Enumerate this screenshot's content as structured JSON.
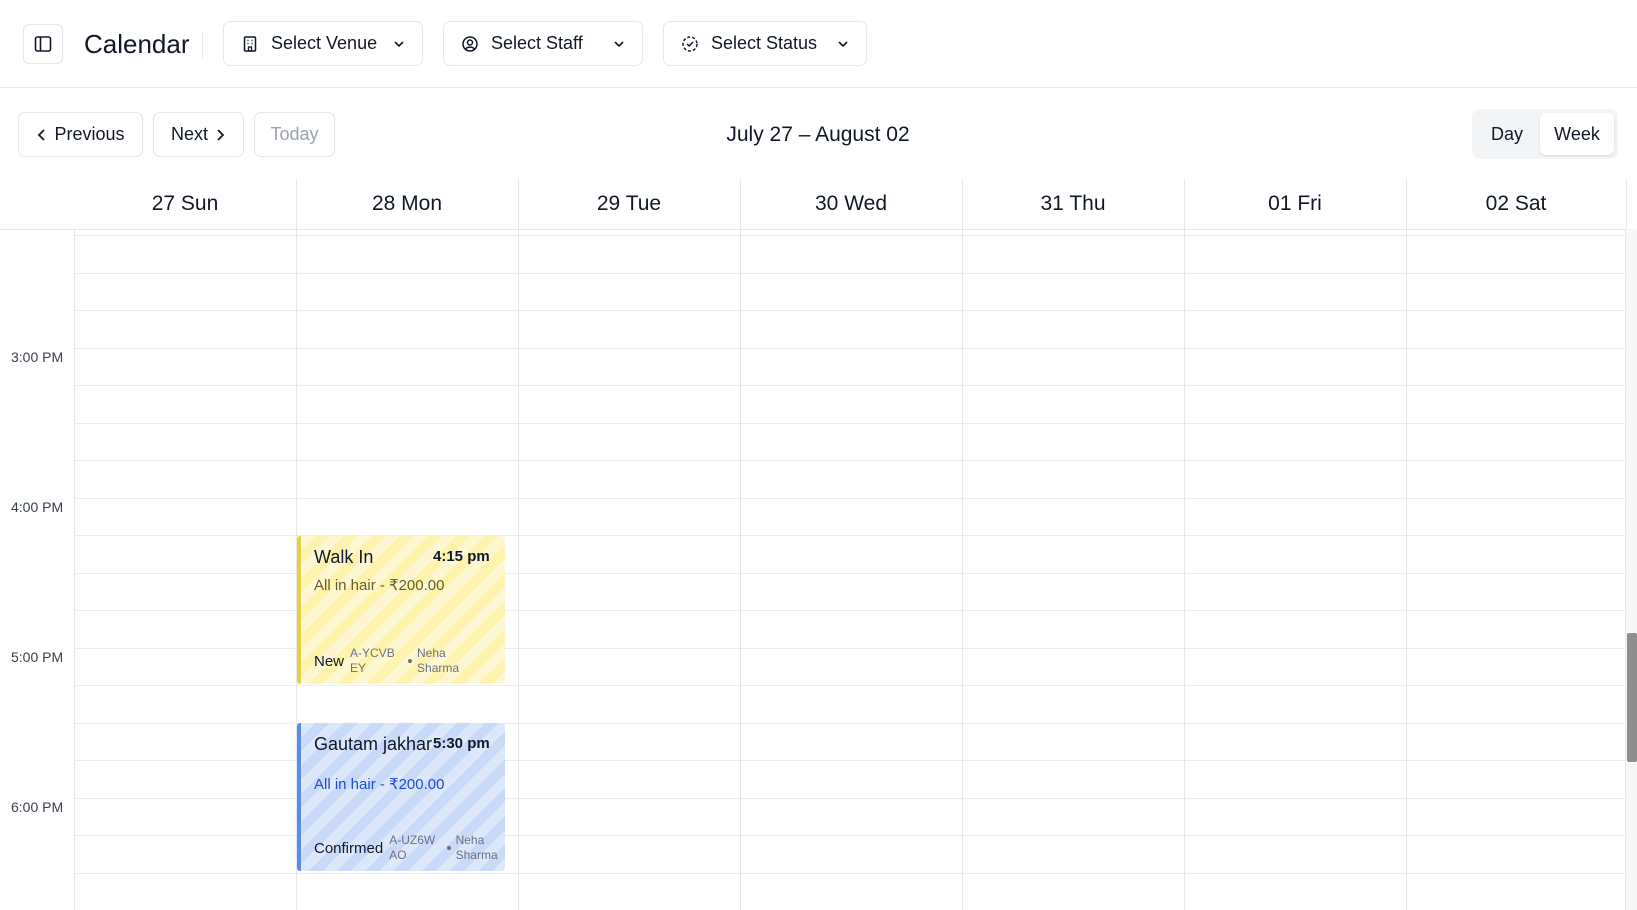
{
  "header": {
    "title": "Calendar",
    "sidebar_toggle_icon": "sidebar-panel-icon",
    "filters": [
      {
        "label": "Select Venue",
        "icon": "building-icon"
      },
      {
        "label": "Select Staff",
        "icon": "user-circle-icon"
      },
      {
        "label": "Select Status",
        "icon": "status-circle-icon"
      }
    ]
  },
  "nav": {
    "previous_label": "Previous",
    "next_label": "Next",
    "today_label": "Today",
    "range_title": "July 27 – August 02",
    "view_day_label": "Day",
    "view_week_label": "Week",
    "active_view": "Week"
  },
  "days": [
    {
      "label": "27 Sun"
    },
    {
      "label": "28 Mon"
    },
    {
      "label": "29 Tue"
    },
    {
      "label": "30 Wed"
    },
    {
      "label": "31 Thu"
    },
    {
      "label": "01 Fri"
    },
    {
      "label": "02 Sat"
    }
  ],
  "time_labels": [
    "3:00 PM",
    "4:00 PM",
    "5:00 PM",
    "6:00 PM"
  ],
  "events": [
    {
      "day": "28 Mon",
      "name": "Walk In",
      "time": "4:15 pm",
      "service": "All in hair - ₹200.00",
      "status": "New",
      "code": "A-YCVBEY",
      "staff": "Neha Sharma",
      "color": "#fdf3ae",
      "accent": "#e6cf45"
    },
    {
      "day": "28 Mon",
      "name": "Gautam jakhar",
      "time": "5:30 pm",
      "service": "All in hair - ₹200.00",
      "status": "Confirmed",
      "code": "A-UZ6WAO",
      "staff": "Neha Sharma",
      "color": "#c9daf8",
      "accent": "#5b8ce6"
    }
  ]
}
